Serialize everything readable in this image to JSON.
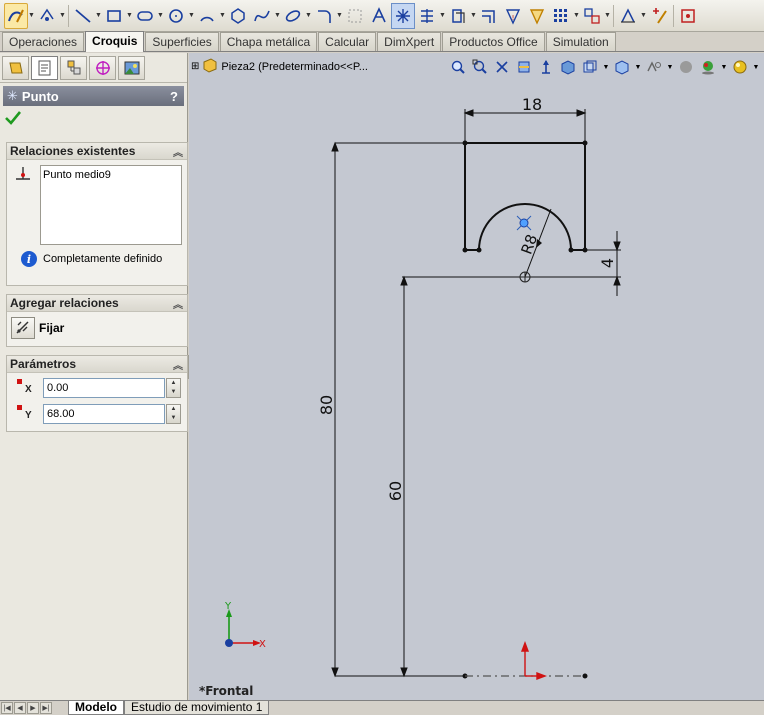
{
  "toolbar": {
    "icons": [
      "sketch-icon",
      "smart-dimension-icon",
      "line-icon",
      "rectangle-icon",
      "slot-icon",
      "circle-icon",
      "arc-icon",
      "polygon-icon",
      "spline-icon",
      "ellipse-icon",
      "fillet-icon",
      "construction-icon",
      "text-icon",
      "point-icon",
      "centerline-icon",
      "offset-icon",
      "trim-icon",
      "mirror-icon",
      "move-icon",
      "pattern-icon",
      "relations-icon",
      "repair-icon",
      "rapid-sketch-icon",
      "instant3d-icon"
    ]
  },
  "command_tabs": [
    {
      "label": "Operaciones",
      "active": false
    },
    {
      "label": "Croquis",
      "active": true
    },
    {
      "label": "Superficies",
      "active": false
    },
    {
      "label": "Chapa metálica",
      "active": false
    },
    {
      "label": "Calcular",
      "active": false
    },
    {
      "label": "DimXpert",
      "active": false
    },
    {
      "label": "Productos Office",
      "active": false
    },
    {
      "label": "Simulation",
      "active": false
    }
  ],
  "property_manager": {
    "title": "Punto",
    "help": "?",
    "existing_relations": {
      "header": "Relaciones existentes",
      "items": [
        "Punto medio9"
      ],
      "status": "Completamente definido"
    },
    "add_relations": {
      "header": "Agregar relaciones",
      "fix_label": "Fijar"
    },
    "parameters": {
      "header": "Parámetros",
      "x_label": "X",
      "x_value": "0.00",
      "y_label": "Y",
      "y_value": "68.00"
    }
  },
  "graphics": {
    "feature_tree_item": "Pieza2  (Predeterminado<<P...",
    "view_name": "*Frontal",
    "dimensions": {
      "width_top": "18",
      "radius": "R8",
      "offset_small": "4",
      "height_total": "80",
      "height_stem": "60"
    },
    "triad": {
      "x": "X",
      "y": "Y"
    }
  },
  "bottom_tabs": [
    {
      "label": "Modelo",
      "active": true
    },
    {
      "label": "Estudio de movimiento 1",
      "active": false
    }
  ],
  "colors": {
    "accent": "#1d5bd0",
    "point_marker": "#d01212",
    "graphics_bg": "#c4c8d1"
  }
}
